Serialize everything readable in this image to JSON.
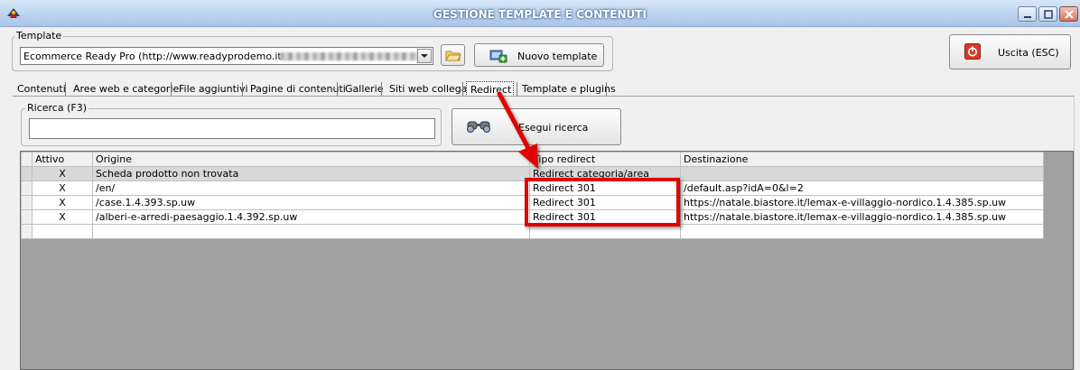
{
  "window": {
    "title": "GESTIONE TEMPLATE E CONTENUTI"
  },
  "template": {
    "group_label": "Template",
    "selected_value": "Ecommerce Ready Pro (http://www.readyprodemo.it ,",
    "new_template_label": "Nuovo template"
  },
  "exit_button": {
    "label": "Uscita (ESC)"
  },
  "tabs": [
    {
      "label": "Contenuti",
      "active": false
    },
    {
      "label": "Aree web e categorie",
      "active": false
    },
    {
      "label": "File aggiuntivi",
      "active": false
    },
    {
      "label": "Pagine di contenuti",
      "active": false
    },
    {
      "label": "Gallerie",
      "active": false
    },
    {
      "label": "Siti web collegati",
      "active": false
    },
    {
      "label": "Redirect",
      "active": true
    },
    {
      "label": "Template e plugins",
      "active": false
    }
  ],
  "search": {
    "group_label": "Ricerca (F3)",
    "value": "",
    "button_label": "Esegui ricerca"
  },
  "table": {
    "columns": [
      "Attivo",
      "Origine",
      "Tipo redirect",
      "Destinazione"
    ],
    "rows": [
      {
        "attivo": "X",
        "origine": "Scheda prodotto non trovata",
        "tipo": "Redirect categoria/area",
        "destinazione": ""
      },
      {
        "attivo": "X",
        "origine": "/en/",
        "tipo": "Redirect 301",
        "destinazione": "/default.asp?idA=0&l=2"
      },
      {
        "attivo": "X",
        "origine": "/case.1.4.393.sp.uw",
        "tipo": "Redirect 301",
        "destinazione": "https://natale.biastore.it/lemax-e-villaggio-nordico.1.4.385.sp.uw"
      },
      {
        "attivo": "X",
        "origine": "/alberi-e-arredi-paesaggio.1.4.392.sp.uw",
        "tipo": "Redirect 301",
        "destinazione": "https://natale.biastore.it/lemax-e-villaggio-nordico.1.4.385.sp.uw"
      },
      {
        "attivo": "",
        "origine": "",
        "tipo": "",
        "destinazione": ""
      }
    ]
  },
  "colors": {
    "annotation": "#e20000",
    "title_bar": "#bcd3ee",
    "grid_background": "#a0a0a0"
  },
  "icons": {
    "app": "app-logo-icon",
    "folder": "folder-icon",
    "add": "add-template-icon",
    "exit": "exit-icon",
    "search": "binoculars-icon"
  }
}
